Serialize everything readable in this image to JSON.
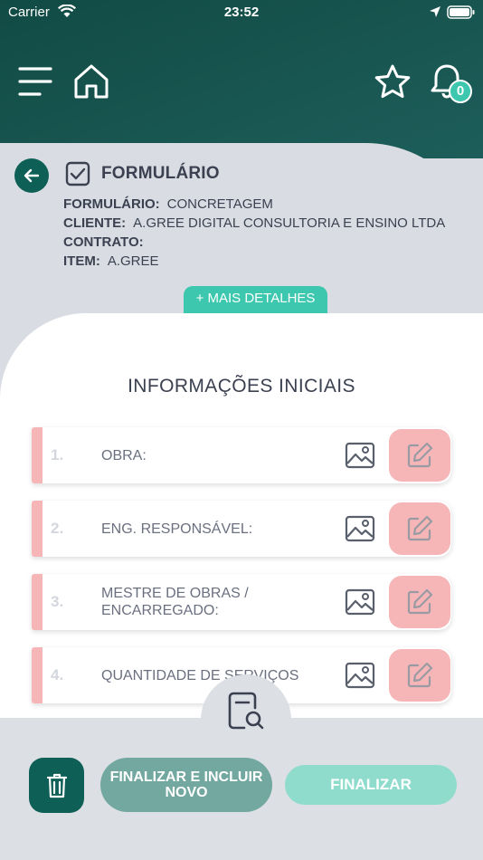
{
  "status_bar": {
    "carrier": "Carrier",
    "time": "23:52"
  },
  "header": {
    "notification_count": "0"
  },
  "form": {
    "title": "FORMULÁRIO",
    "meta": [
      {
        "label": "FORMULÁRIO:",
        "value": "CONCRETAGEM"
      },
      {
        "label": "CLIENTE:",
        "value": "A.GREE DIGITAL CONSULTORIA E ENSINO LTDA"
      },
      {
        "label": "CONTRATO:",
        "value": ""
      },
      {
        "label": "ITEM:",
        "value": "A.GREE"
      }
    ],
    "more_details_label": "+ MAIS DETALHES"
  },
  "section": {
    "title": "INFORMAÇÕES INICIAIS",
    "questions": [
      {
        "number": "1.",
        "label": "OBRA:"
      },
      {
        "number": "2.",
        "label": "ENG. RESPONSÁVEL:"
      },
      {
        "number": "3.",
        "label": "MESTRE DE OBRAS / ENCARREGADO:"
      },
      {
        "number": "4.",
        "label": "QUANTIDADE DE SERVIÇOS"
      }
    ]
  },
  "actions": {
    "finish_and_new_label": "FINALIZAR E INCLUIR NOVO",
    "finish_label": "FINALIZAR"
  },
  "colors": {
    "header": "#124b45",
    "accent": "#3cc7ae",
    "dark_green": "#0e5f55",
    "pending": "#f6b6b8"
  }
}
